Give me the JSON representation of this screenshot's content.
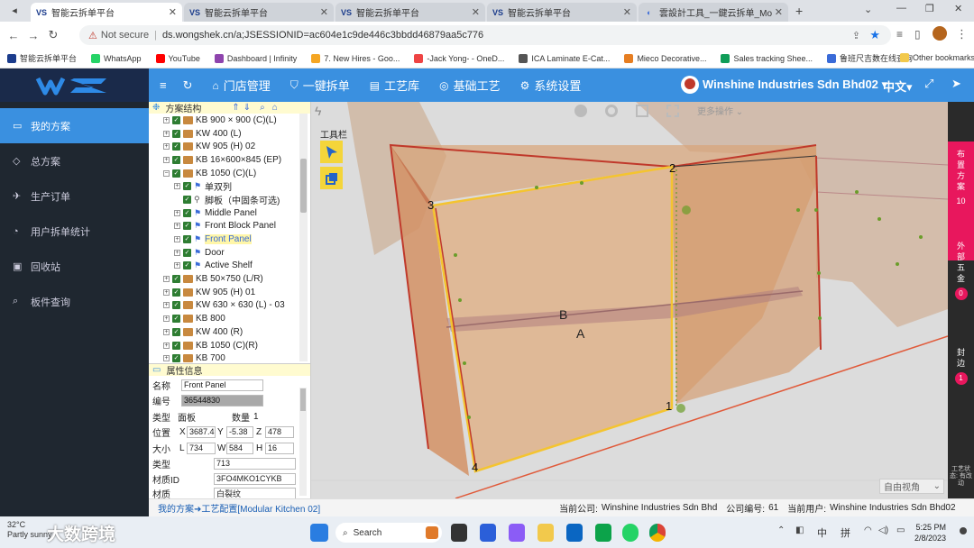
{
  "browser": {
    "tabs": [
      {
        "title": "智能云拆单平台",
        "active": true
      },
      {
        "title": "智能云拆单平台",
        "active": false
      },
      {
        "title": "智能云拆单平台",
        "active": false
      },
      {
        "title": "智能云拆单平台",
        "active": false
      },
      {
        "title": "雲設計工具_一鍵云拆单_Modular",
        "active": false
      }
    ],
    "security_label": "Not secure",
    "url": "ds.wongshek.cn/a;JSESSIONID=ac604e1c9de446c3bbdd46879aa5c776",
    "bookmarks": [
      {
        "label": "智能云拆单平台",
        "color": "#1b3c8c"
      },
      {
        "label": "WhatsApp",
        "color": "#25d366"
      },
      {
        "label": "YouTube",
        "color": "#ff0000"
      },
      {
        "label": "Dashboard | Infinity",
        "color": "#8e44ad"
      },
      {
        "label": "7. New Hires - Goo...",
        "color": "#f5a623"
      },
      {
        "label": "-Jack Yong- - OneD...",
        "color": "#e44"
      },
      {
        "label": "ICA Laminate E-Cat...",
        "color": "#555"
      },
      {
        "label": "Mieco Decorative...",
        "color": "#e67e22"
      },
      {
        "label": "Sales tracking Shee...",
        "color": "#0f9d58"
      },
      {
        "label": "鲁班尺吉数在线查询",
        "color": "#3a6bd8"
      }
    ],
    "other_bookmarks": "Other bookmarks"
  },
  "header": {
    "logo": "WS",
    "nav": [
      {
        "icon": "≡",
        "label": ""
      },
      {
        "icon": "↻",
        "label": ""
      },
      {
        "icon": "⌂",
        "label": "门店管理"
      },
      {
        "icon": "⛉",
        "label": "一键拆单"
      },
      {
        "icon": "▤",
        "label": "工艺库"
      },
      {
        "icon": "◎",
        "label": "基础工艺"
      },
      {
        "icon": "⚙",
        "label": "系统设置"
      }
    ],
    "company": "Winshine Industries Sdn Bhd02",
    "language": "中文"
  },
  "sidebar": {
    "items": [
      {
        "icon": "▭",
        "label": "我的方案",
        "active": true
      },
      {
        "icon": "◇",
        "label": "总方案",
        "active": false
      },
      {
        "icon": "✈",
        "label": "生产订单",
        "active": false
      },
      {
        "icon": "◔",
        "label": "用户拆单统计",
        "active": false
      },
      {
        "icon": "▣",
        "label": "回收站",
        "active": false
      },
      {
        "icon": "⌕",
        "label": "板件查询",
        "active": false
      }
    ]
  },
  "tree": {
    "title": "方案结构",
    "rows": [
      {
        "label": "KB 900 × 900 (C)(L)",
        "level": 0,
        "type": "box",
        "exp": "+"
      },
      {
        "label": "KW 400 (L)",
        "level": 0,
        "type": "box",
        "exp": "+"
      },
      {
        "label": "KW 905 (H) 02",
        "level": 0,
        "type": "box",
        "exp": "+"
      },
      {
        "label": "KB 16×600×845 (EP)",
        "level": 0,
        "type": "box",
        "exp": "+"
      },
      {
        "label": "KB 1050 (C)(L)",
        "level": 0,
        "type": "box",
        "exp": "−"
      },
      {
        "label": "单双列",
        "level": 1,
        "type": "flag",
        "exp": "+"
      },
      {
        "label": "脚板（中固条可选)",
        "level": 1,
        "type": "leg",
        "exp": ""
      },
      {
        "label": "Middle Panel",
        "level": 1,
        "type": "flag",
        "exp": "+"
      },
      {
        "label": "Front Block Panel",
        "level": 1,
        "type": "flag",
        "exp": "+"
      },
      {
        "label": "Front Panel",
        "level": 1,
        "type": "flag",
        "exp": "+",
        "selected": true
      },
      {
        "label": "Door",
        "level": 1,
        "type": "flag",
        "exp": "+"
      },
      {
        "label": "Active Shelf",
        "level": 1,
        "type": "flag",
        "exp": "+"
      },
      {
        "label": "KB 50×750 (L/R)",
        "level": 0,
        "type": "box",
        "exp": "+"
      },
      {
        "label": "KW 905 (H) 01",
        "level": 0,
        "type": "box",
        "exp": "+"
      },
      {
        "label": "KW 630 × 630 (L) - 03",
        "level": 0,
        "type": "box",
        "exp": "+"
      },
      {
        "label": "KB 800",
        "level": 0,
        "type": "box",
        "exp": "+"
      },
      {
        "label": "KW 400 (R)",
        "level": 0,
        "type": "box",
        "exp": "+"
      },
      {
        "label": "KB 1050 (C)(R)",
        "level": 0,
        "type": "box",
        "exp": "+"
      },
      {
        "label": "KB 700",
        "level": 0,
        "type": "box",
        "exp": "+"
      }
    ]
  },
  "properties": {
    "title": "属性信息",
    "name_label": "名称",
    "name_value": "Front Panel",
    "code_label": "编号",
    "code_value": "36544830",
    "type_label": "类型",
    "type_value": "面板",
    "qty_label": "数量",
    "qty_value": "1",
    "pos_label": "位置",
    "x_label": "X",
    "x_value": "3687.4",
    "y_label": "Y",
    "y_value": "-5.38",
    "z_label": "Z",
    "z_value": "478",
    "size_label": "大小",
    "l_label": "L",
    "l_value": "734",
    "w_label": "W",
    "w_value": "584",
    "h_label": "H",
    "h_value": "16",
    "type2_label": "类型",
    "type2_value": "713",
    "material_id_label": "材质ID",
    "material_id_value": "3FO4MKO1CYKB",
    "material_label": "材质",
    "material_value": "白裂纹"
  },
  "viewport": {
    "toolbar_label": "工具栏",
    "more_label": "更多操作",
    "view_mode": "自由视角",
    "markers": [
      "1",
      "2",
      "3",
      "4"
    ],
    "letters": [
      "A",
      "B"
    ]
  },
  "right_panel": {
    "items": [
      {
        "label": "布置方案",
        "count": "10"
      },
      {
        "label": "外部五金",
        "count": "0"
      },
      {
        "label": "封边",
        "count": "1"
      }
    ],
    "footer": "工艺状态: 有改动"
  },
  "status": {
    "breadcrumb": "我的方案➜工艺配置[Modular Kitchen 02]",
    "company_label": "当前公司:",
    "company": "Winshine Industries Sdn Bhd",
    "code_label": "公司编号:",
    "code": "61",
    "user_label": "当前用户:",
    "user": "Winshine Industries Sdn Bhd02"
  },
  "taskbar": {
    "weather_temp": "32°C",
    "weather_desc": "Partly sunny",
    "watermark": "大数跨境",
    "search": "Search",
    "lang1": "中",
    "lang2": "拼",
    "time": "5:25 PM",
    "date": "2/8/2023"
  }
}
